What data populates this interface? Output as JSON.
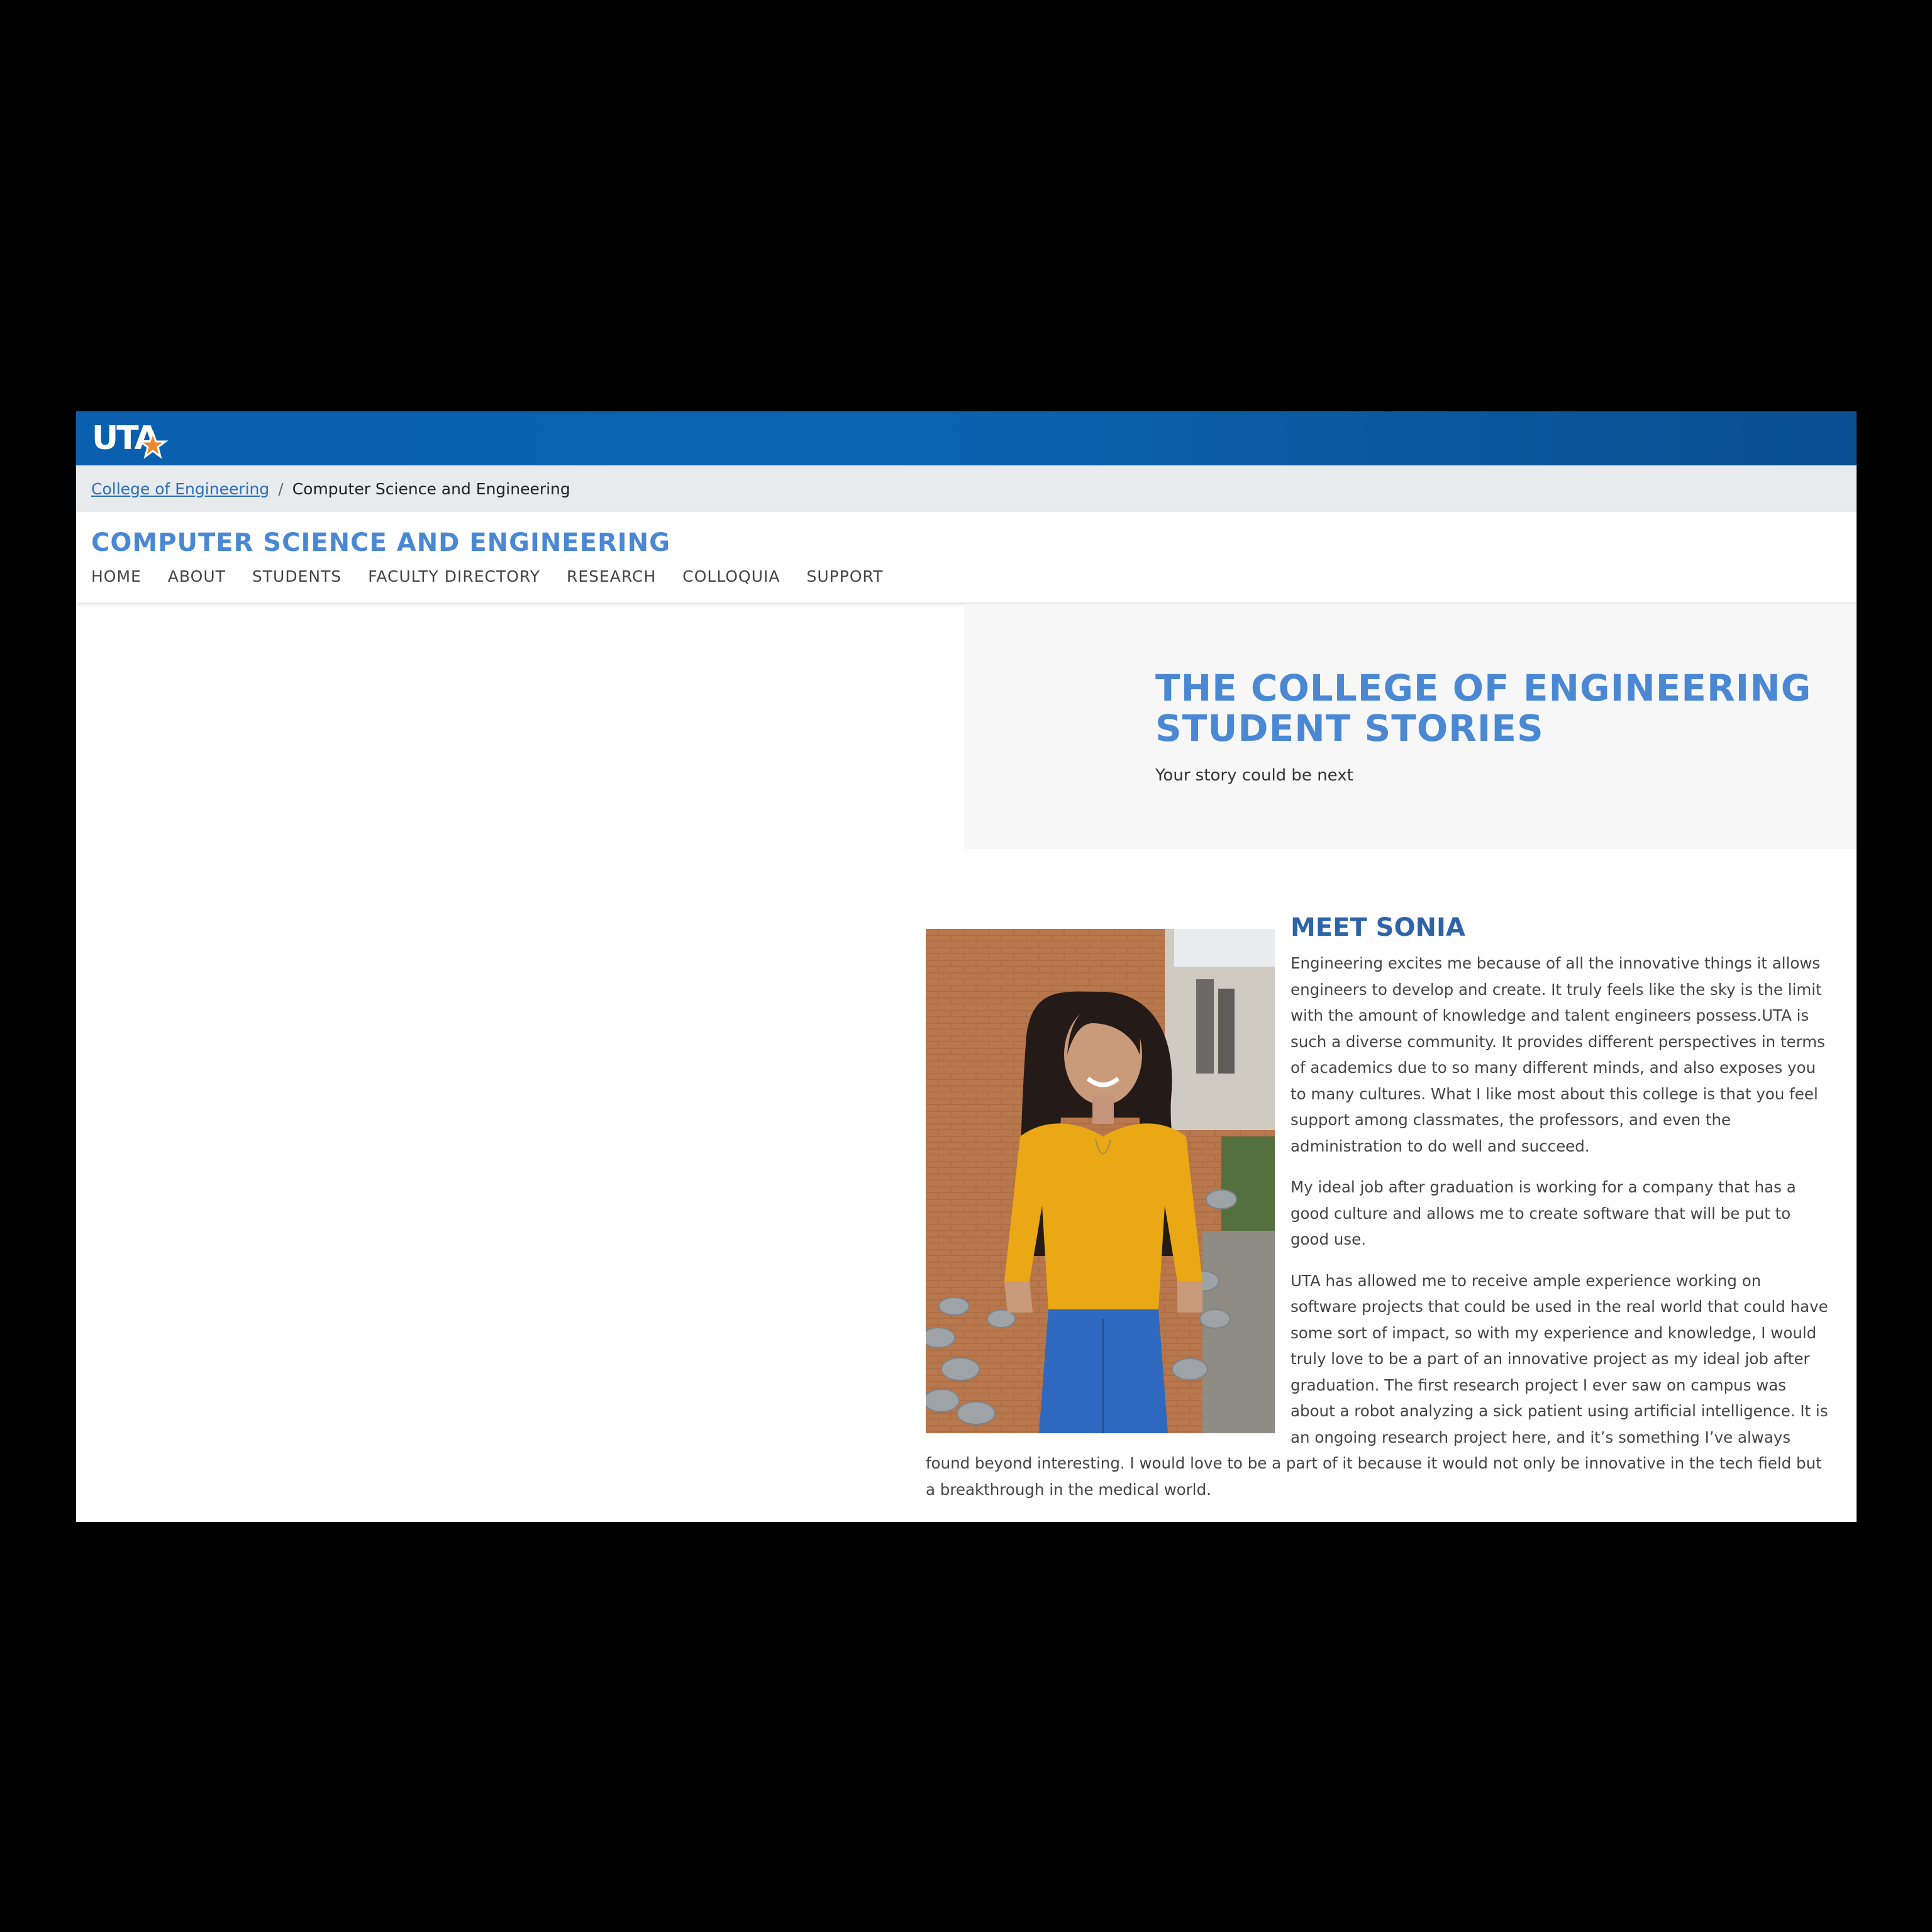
{
  "header": {
    "logo_text": "UTA"
  },
  "breadcrumb": {
    "items": [
      {
        "label": "College of Engineering"
      },
      {
        "label": "Computer Science and Engineering"
      }
    ],
    "separator": "/"
  },
  "site": {
    "title": "Computer Science and Engineering",
    "nav": [
      {
        "label": "HOME"
      },
      {
        "label": "ABOUT"
      },
      {
        "label": "STUDENTS"
      },
      {
        "label": "FACULTY DIRECTORY"
      },
      {
        "label": "RESEARCH"
      },
      {
        "label": "COLLOQUIA"
      },
      {
        "label": "SUPPORT"
      }
    ]
  },
  "hero": {
    "title": "The College of Engineering Student Stories",
    "subtitle": "Your story could be next"
  },
  "story": {
    "heading": "Meet Sonia",
    "paragraphs": [
      "Engineering excites me because of all the innovative things it allows engineers to develop and create. It truly feels like the sky is the limit with the amount of knowledge and talent engineers possess.UTA is such a diverse community. It provides different perspectives in terms of academics due to so many different minds, and also exposes you to many cultures. What I like most about this college is that you feel support among classmates, the professors, and even the administration to do well and succeed.",
      "My ideal job after graduation is working for a company that has a good culture and allows me to create software that will be put to good use.",
      "UTA has allowed me to receive ample experience working on software projects that could be used in the real world that could have some sort of impact, so with my experience and knowledge, I would truly love to be a part of an innovative project as my ideal job after graduation. The first research project I ever saw on campus was about a robot analyzing a sick patient using artificial intelligence. It is an ongoing research project here, and it’s something I’ve always found beyond interesting. I would love to be a part of it because it would not only be innovative in the tech field but a breakthrough in the medical world."
    ]
  },
  "colors": {
    "brand_blue": "#0a5fae",
    "title_blue": "#4a88d3",
    "heading_blue": "#2d64a8",
    "breadcrumb_bg": "#e7ebee",
    "hero_bg": "#f7f7f7"
  }
}
